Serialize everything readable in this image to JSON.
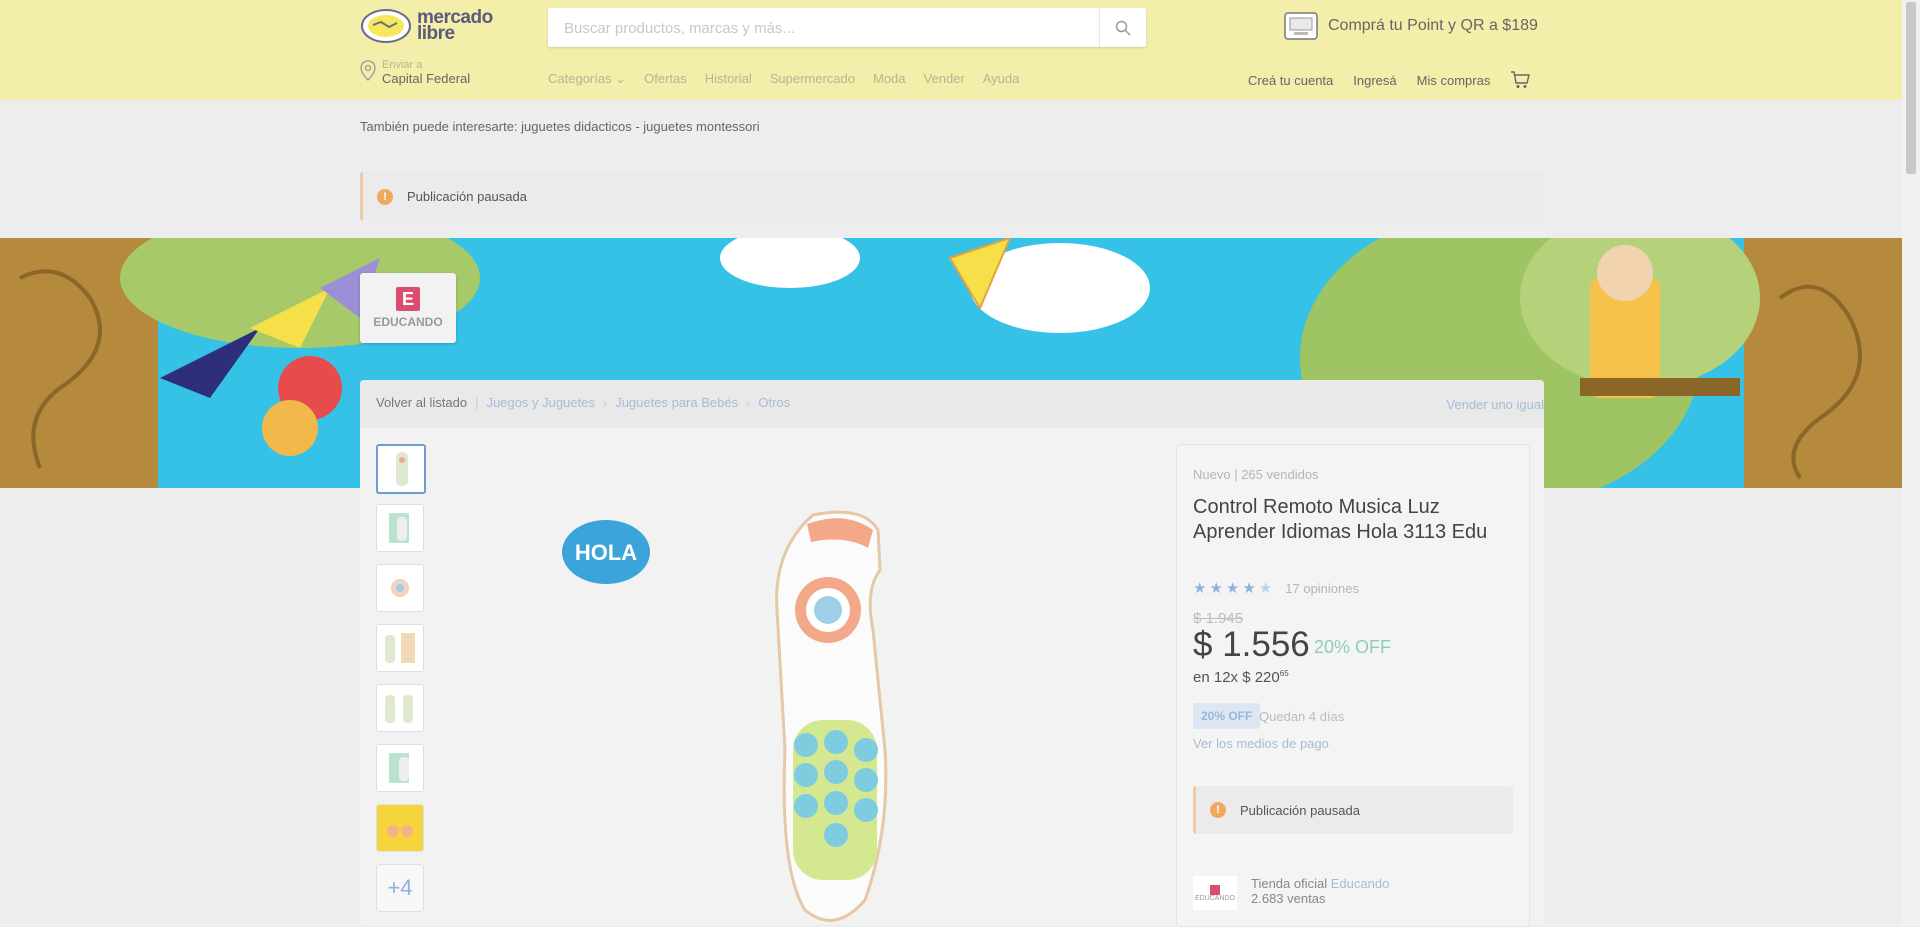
{
  "header": {
    "logo_line1": "mercado",
    "logo_line2": "libre",
    "search_placeholder": "Buscar productos, marcas y más...",
    "promo": "Comprá tu Point y QR a $189",
    "location_label": "Enviar a",
    "location_value": "Capital Federal",
    "nav": [
      "Categorías",
      "Ofertas",
      "Historial",
      "Supermercado",
      "Moda",
      "Vender",
      "Ayuda"
    ],
    "account": [
      "Creá tu cuenta",
      "Ingresá",
      "Mis compras"
    ]
  },
  "related": {
    "text": "También puede interesarte:",
    "links": "juguetes didacticos - juguetes montessori"
  },
  "alert": {
    "text": "Publicación pausada"
  },
  "store": {
    "name": "EDUCANDO",
    "letter": "E"
  },
  "breadcrumb": {
    "back": "Volver al listado",
    "items": [
      "Juegos y Juguetes",
      "Juguetes para Bebés",
      "Otros"
    ],
    "sell_same": "Vender uno igual"
  },
  "gallery": {
    "more": "+4",
    "brand": "HOLA"
  },
  "product": {
    "condition": "Nuevo",
    "sold": "265 vendidos",
    "title": "Control Remoto Musica Luz Aprender Idiomas Hola 3113 Edu",
    "rating": 4.5,
    "opinions": "17 opiniones",
    "old_price": "$ 1.945",
    "price": "$ 1.556",
    "discount": "20% OFF",
    "installments_prefix": "en 12x $ 220",
    "installments_cents": "65",
    "tag": "20% OFF",
    "days_left": "Quedan 4 días",
    "payment_link": "Ver los medios de pago",
    "alert": "Publicación pausada"
  },
  "seller": {
    "prefix": "Tienda oficial",
    "name": "Educando",
    "sales": "2.683 ventas"
  },
  "colors": {
    "header_bg": "#f3eeaa",
    "link": "#a4bdd6",
    "discount": "#8ccfb3",
    "alert": "#f0a95c"
  }
}
